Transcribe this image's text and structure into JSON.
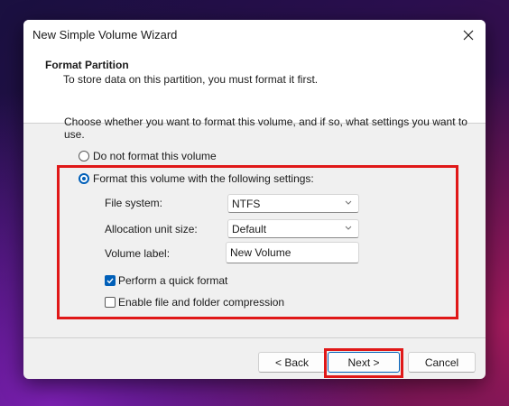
{
  "window": {
    "title": "New Simple Volume Wizard"
  },
  "header": {
    "title": "Format Partition",
    "subtitle": "To store data on this partition, you must format it first."
  },
  "prompt": "Choose whether you want to format this volume, and if so, what settings you want to use.",
  "options": {
    "no_format": {
      "label": "Do not format this volume",
      "selected": false
    },
    "format": {
      "label": "Format this volume with the following settings:",
      "selected": true
    }
  },
  "settings": {
    "file_system": {
      "label": "File system:",
      "value": "NTFS"
    },
    "allocation_unit_size": {
      "label": "Allocation unit size:",
      "value": "Default"
    },
    "volume_label": {
      "label": "Volume label:",
      "value": "New Volume"
    }
  },
  "checkboxes": {
    "quick_format": {
      "label": "Perform a quick format",
      "checked": true
    },
    "compression": {
      "label": "Enable file and folder compression",
      "checked": false
    }
  },
  "buttons": {
    "back": "< Back",
    "next": "Next >",
    "cancel": "Cancel"
  },
  "colors": {
    "accent": "#005fb8",
    "highlight": "#e01818",
    "dialog_bg": "#f0f0f0"
  },
  "icons": {
    "close": "close-icon",
    "dropdown": "chevron-down-icon",
    "check": "checkmark-icon"
  }
}
